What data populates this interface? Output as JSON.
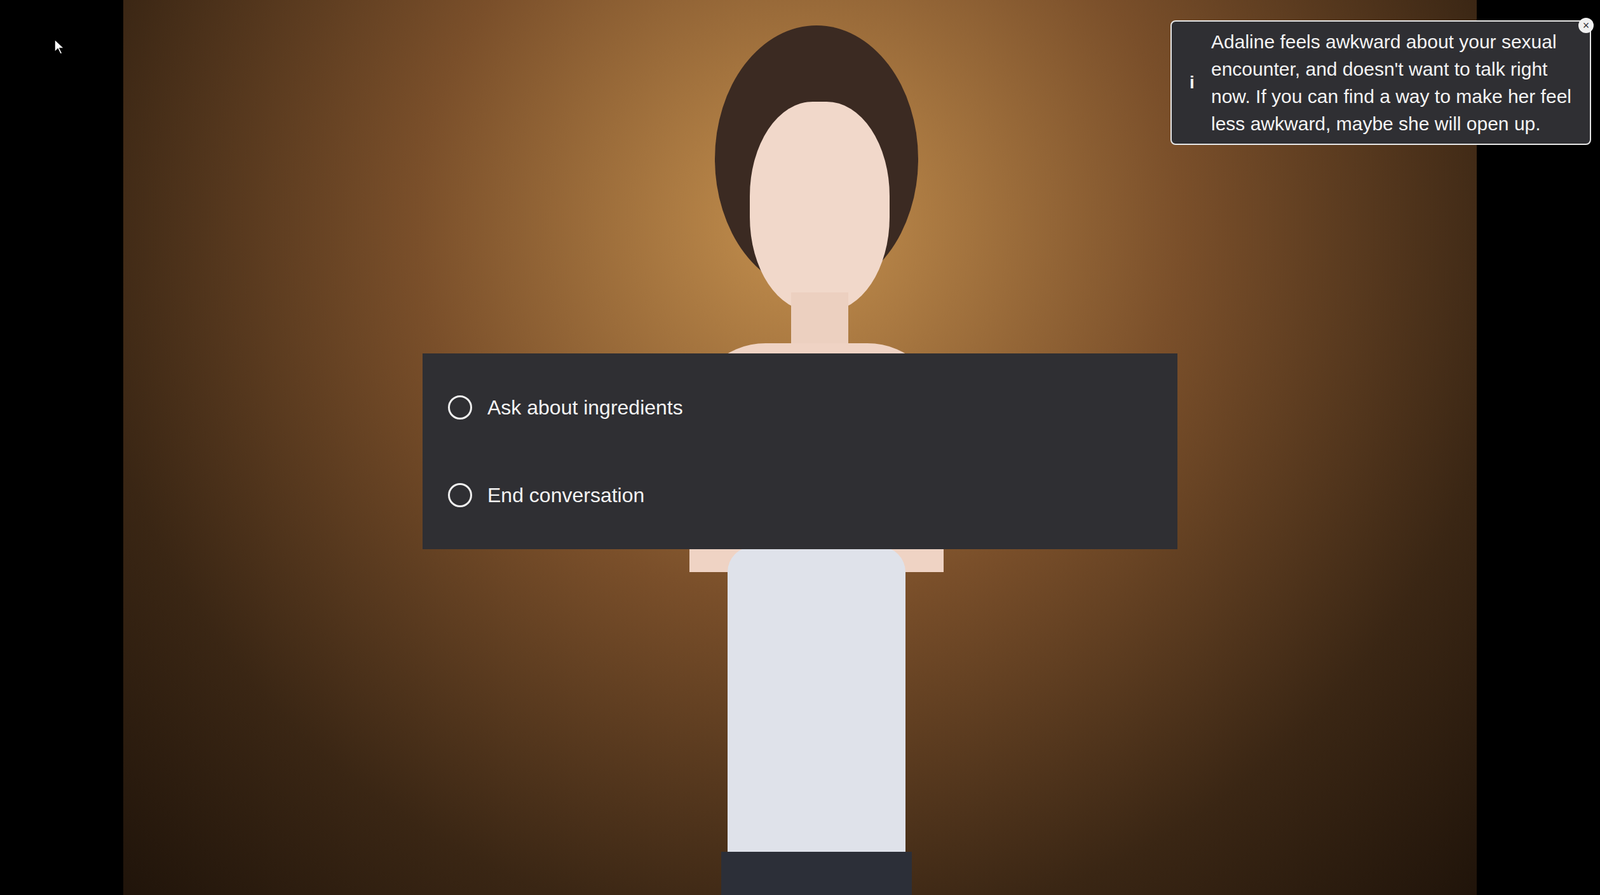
{
  "hint": {
    "icon": "i",
    "text": "Adaline feels awkward about your sexual encounter, and doesn't want to talk right now. If you can find a way to make her feel less awkward, maybe she will open up.",
    "close": "×"
  },
  "choices": [
    {
      "label": "Ask about ingredients",
      "selected": false
    },
    {
      "label": "End conversation",
      "selected": false
    }
  ]
}
